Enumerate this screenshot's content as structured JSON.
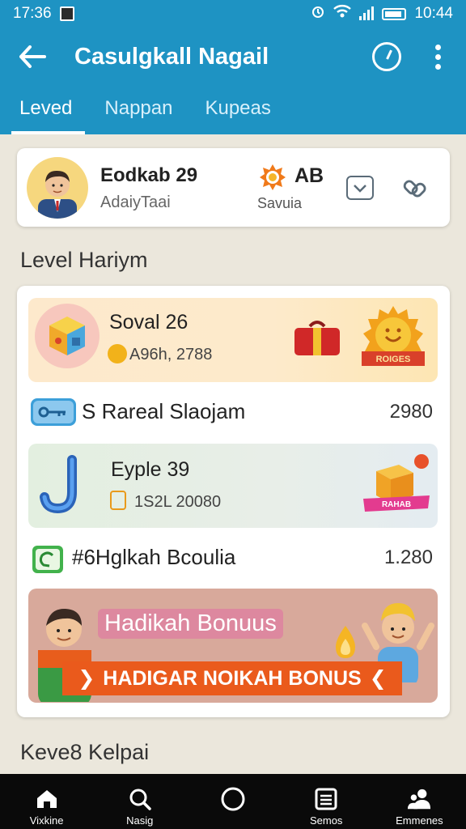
{
  "status_bar": {
    "time_left": "17:36",
    "time_right": "10:44"
  },
  "app_bar": {
    "title": "Casulgkall Nagail",
    "tabs": [
      {
        "label": "Leved",
        "active": true
      },
      {
        "label": "Nappan",
        "active": false
      },
      {
        "label": "Kupeas",
        "active": false
      }
    ]
  },
  "profile": {
    "name": "Eodkab 29",
    "subtitle": "AdaiyTaai",
    "badge_label": "AB",
    "badge_sub": "Savuia"
  },
  "section_title": "Level Hariym",
  "levels": [
    {
      "title": "Soval 26",
      "sub": "A96h, 2788",
      "badge_text": "ROIGES"
    },
    {
      "title": "Eyple 39",
      "sub": "1S2L 20080",
      "badge_text": "RAHAB"
    }
  ],
  "rows": [
    {
      "label": "S Rareal Slaojam",
      "value": "2980"
    },
    {
      "label": "#6Hglkah Bcoulia",
      "value": "1.280"
    }
  ],
  "banner": {
    "title": "Hadikah Bonuus",
    "cta": "HADIGAR NOIKAH BONUS"
  },
  "section_title_2": "Keve8 Kelpai",
  "bottom_nav": [
    {
      "label": "Vixkine",
      "icon": "home-icon"
    },
    {
      "label": "Nasig",
      "icon": "search-icon"
    },
    {
      "label": "",
      "icon": "circle-icon"
    },
    {
      "label": "Semos",
      "icon": "list-icon"
    },
    {
      "label": "Emmenes",
      "icon": "people-icon"
    }
  ],
  "colors": {
    "primary": "#1e93c3",
    "accent": "#ea5a1c",
    "background": "#ebe7dc"
  }
}
